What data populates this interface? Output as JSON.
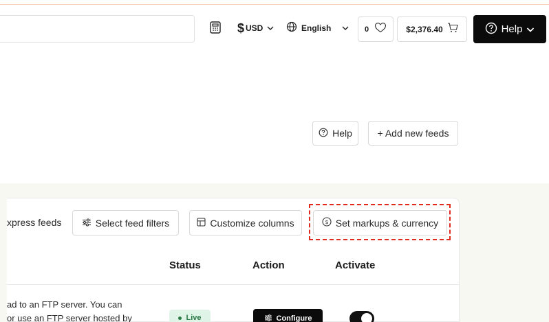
{
  "header": {
    "currency_symbol": "$",
    "currency_code": "USD",
    "language": "English",
    "wishlist_count": "0",
    "cart_total": "$2,376.40",
    "help_label": "Help"
  },
  "actions": {
    "help_label": "Help",
    "add_feeds_label": "+ Add new feeds"
  },
  "toolbar": {
    "feeds_text": "xpress feeds",
    "filters_label": "Select feed filters",
    "columns_label": "Customize columns",
    "markups_label": "Set markups & currency"
  },
  "table": {
    "columns": [
      "Status",
      "Action",
      "Activate"
    ],
    "row": {
      "description_line1": "ad to an FTP server. You can",
      "description_line2": "or use an FTP server hosted by",
      "status": "Live",
      "action": "Configure",
      "activate": true
    }
  },
  "colors": {
    "highlight": "#e02a1f",
    "status_live_bg": "#dff3e6",
    "status_live_text": "#2a7a45"
  }
}
